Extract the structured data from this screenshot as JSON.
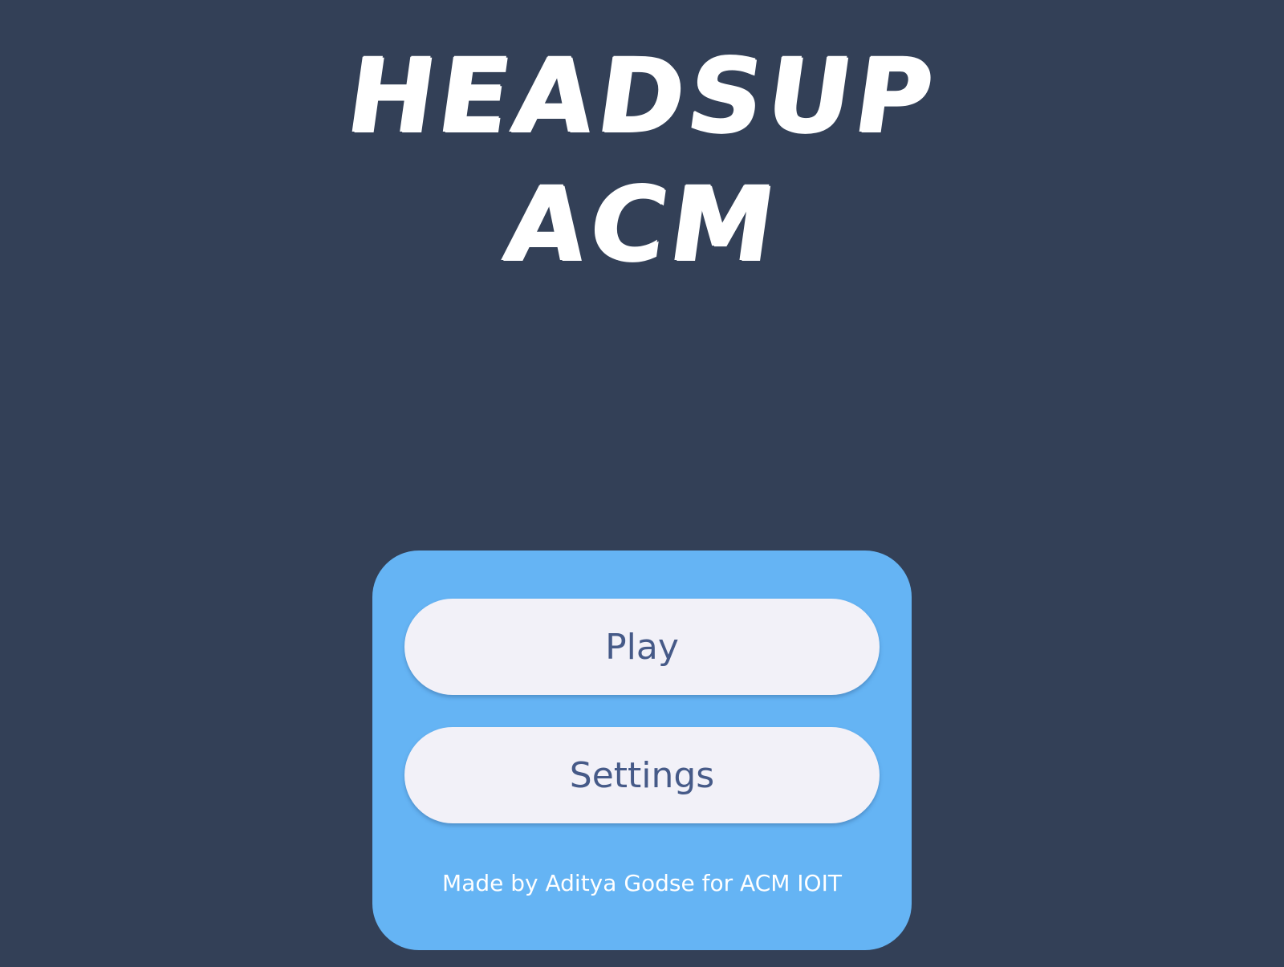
{
  "title": {
    "line1": "HEADSUP",
    "line2": "ACM"
  },
  "menu": {
    "play_label": "Play",
    "settings_label": "Settings",
    "credit": "Made by Aditya Godse for ACM IOIT"
  },
  "colors": {
    "background": "#334057",
    "card": "#65b4f4",
    "button": "#f2f1f8",
    "button_text": "#465a88",
    "title_text": "#ffffff"
  }
}
